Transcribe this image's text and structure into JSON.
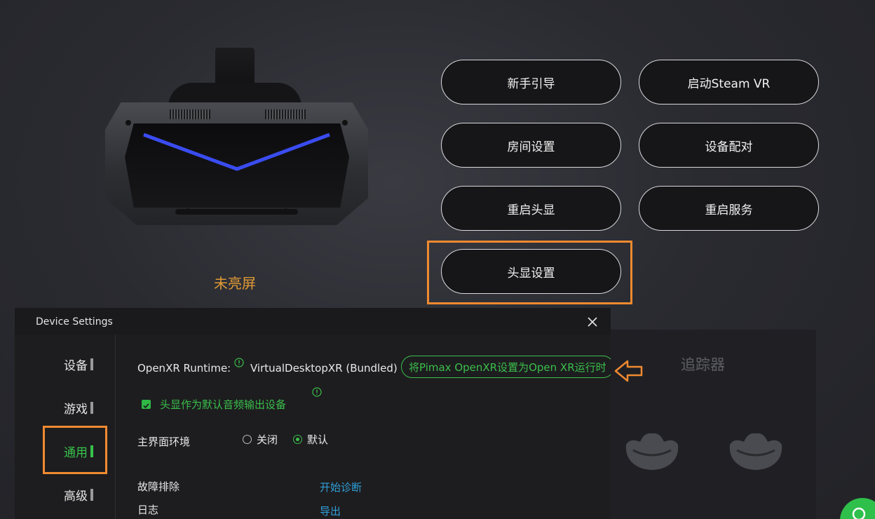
{
  "headset": {
    "status": "未亮屏",
    "status_color": "#e09a35",
    "led_color": "#3a4cf0"
  },
  "actions": {
    "beginner_guide": "新手引导",
    "start_steamvr": "启动Steam VR",
    "room_setup": "房间设置",
    "device_pairing": "设备配对",
    "restart_headset": "重启头显",
    "restart_service": "重启服务",
    "headset_settings": "头显设置"
  },
  "tracker_panel": {
    "title": "追踪器"
  },
  "dialog": {
    "title": "Device Settings",
    "nav": [
      {
        "label": "设备",
        "active": false
      },
      {
        "label": "游戏",
        "active": false
      },
      {
        "label": "通用",
        "active": true
      },
      {
        "label": "高级",
        "active": false
      }
    ],
    "openxr": {
      "label": "OpenXR Runtime:",
      "value": "VirtualDesktopXR (Bundled)",
      "set_button": "将Pimax OpenXR设置为Open XR运行时"
    },
    "audio_default": {
      "label": "头显作为默认音频输出设备",
      "checked": true
    },
    "home_env": {
      "label": "主界面环境",
      "options": [
        {
          "label": "关闭",
          "selected": false
        },
        {
          "label": "默认",
          "selected": true
        }
      ]
    },
    "troubleshoot": {
      "label": "故障排除",
      "action": "开始诊断"
    },
    "log": {
      "label": "日志",
      "action": "导出"
    }
  },
  "colors": {
    "accent_green": "#3bbf4c",
    "highlight_orange": "#f08a30",
    "link_blue": "#2f9fd8"
  }
}
